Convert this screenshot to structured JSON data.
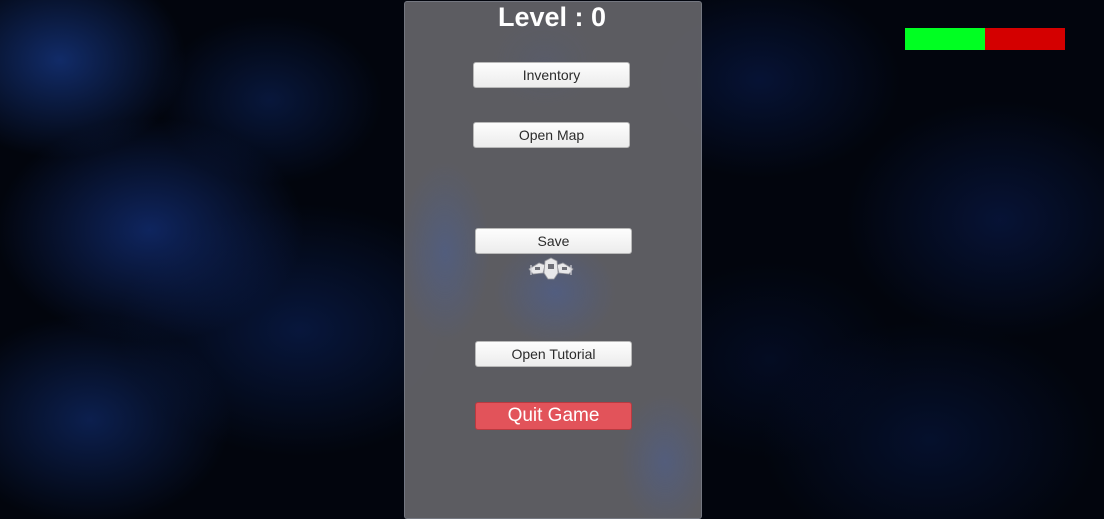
{
  "hud": {
    "level_text": "Level : 0",
    "health_bar": {
      "fill_fraction": 0.5,
      "fill_color": "#00ff22",
      "empty_color": "#d40000"
    }
  },
  "pause_menu": {
    "buttons": {
      "inventory": "Inventory",
      "open_map": "Open Map",
      "save": "Save",
      "open_tutorial": "Open Tutorial",
      "quit_game": "Quit Game"
    },
    "quit_color": "#e2535a"
  },
  "player": {
    "icon": "spaceship-icon"
  }
}
